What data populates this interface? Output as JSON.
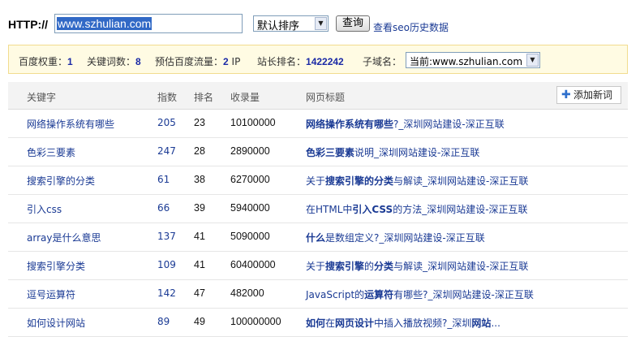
{
  "query": {
    "protocol_label": "HTTP://",
    "domain_value": "www.szhulian.com",
    "sort_selected": "默认排序",
    "query_label": "查询",
    "history_link": "查看seo历史数据"
  },
  "stats": {
    "baidu_weight_label": "百度权重：",
    "baidu_weight": "1",
    "keyword_count_label": "关键词数：",
    "keyword_count": "8",
    "traffic_label": "预估百度流量：",
    "traffic_value": "2",
    "traffic_unit": "IP",
    "rank_label": "站长排名：",
    "rank_value": "1422242",
    "subdomain_label": "子域名：",
    "subdomain_selected": "当前:www.szhulian.com"
  },
  "table": {
    "headers": [
      "关键字",
      "指数",
      "排名",
      "收录量",
      "网页标题"
    ],
    "add_label": "添加新词",
    "rows": [
      {
        "keyword": "网络操作系统有哪些",
        "index": "205",
        "rank": "23",
        "count": "10100000",
        "title_parts": [
          {
            "t": "网络操作系统有哪些",
            "b": true
          },
          {
            "t": "?_深圳网站建设-深正互联",
            "b": false
          }
        ]
      },
      {
        "keyword": "色彩三要素",
        "index": "247",
        "rank": "28",
        "count": "2890000",
        "title_parts": [
          {
            "t": "色彩三要素",
            "b": true
          },
          {
            "t": "说明_深圳网站建设-深正互联",
            "b": false
          }
        ]
      },
      {
        "keyword": "搜索引擎的分类",
        "index": "61",
        "rank": "38",
        "count": "6270000",
        "title_parts": [
          {
            "t": "关于",
            "b": false
          },
          {
            "t": "搜索引擎的分类",
            "b": true
          },
          {
            "t": "与解读_深圳网站建设-深正互联",
            "b": false
          }
        ]
      },
      {
        "keyword": "引入css",
        "index": "66",
        "rank": "39",
        "count": "5940000",
        "title_parts": [
          {
            "t": "在HTML中",
            "b": false
          },
          {
            "t": "引入CSS",
            "b": true
          },
          {
            "t": "的方法_深圳网站建设-深正互联",
            "b": false
          }
        ]
      },
      {
        "keyword": "array是什么意思",
        "index": "137",
        "rank": "41",
        "count": "5090000",
        "title_parts": [
          {
            "t": "什么",
            "b": true
          },
          {
            "t": "是数组定义?_深圳网站建设-深正互联",
            "b": false
          }
        ]
      },
      {
        "keyword": "搜索引擎分类",
        "index": "109",
        "rank": "41",
        "count": "60400000",
        "title_parts": [
          {
            "t": "关于",
            "b": false
          },
          {
            "t": "搜索引擎",
            "b": true
          },
          {
            "t": "的",
            "b": false
          },
          {
            "t": "分类",
            "b": true
          },
          {
            "t": "与解读_深圳网站建设-深正互联",
            "b": false
          }
        ]
      },
      {
        "keyword": "逗号运算符",
        "index": "142",
        "rank": "47",
        "count": "482000",
        "title_parts": [
          {
            "t": "JavaScript的",
            "b": false
          },
          {
            "t": "运算符",
            "b": true
          },
          {
            "t": "有哪些?_深圳网站建设-深正互联",
            "b": false
          }
        ]
      },
      {
        "keyword": "如何设计网站",
        "index": "89",
        "rank": "49",
        "count": "100000000",
        "title_parts": [
          {
            "t": "如何",
            "b": true
          },
          {
            "t": "在",
            "b": false
          },
          {
            "t": "网页设计",
            "b": true
          },
          {
            "t": "中插入播放视频?_深圳",
            "b": false
          },
          {
            "t": "网站",
            "b": true
          },
          {
            "t": "...",
            "b": false
          }
        ]
      }
    ]
  },
  "colors": {
    "link": "#1a3a94",
    "stats_bg": "#fffbe3",
    "stats_border": "#f1dc8f",
    "selection": "#3169c6",
    "header_bg": "#f3f3f3"
  }
}
